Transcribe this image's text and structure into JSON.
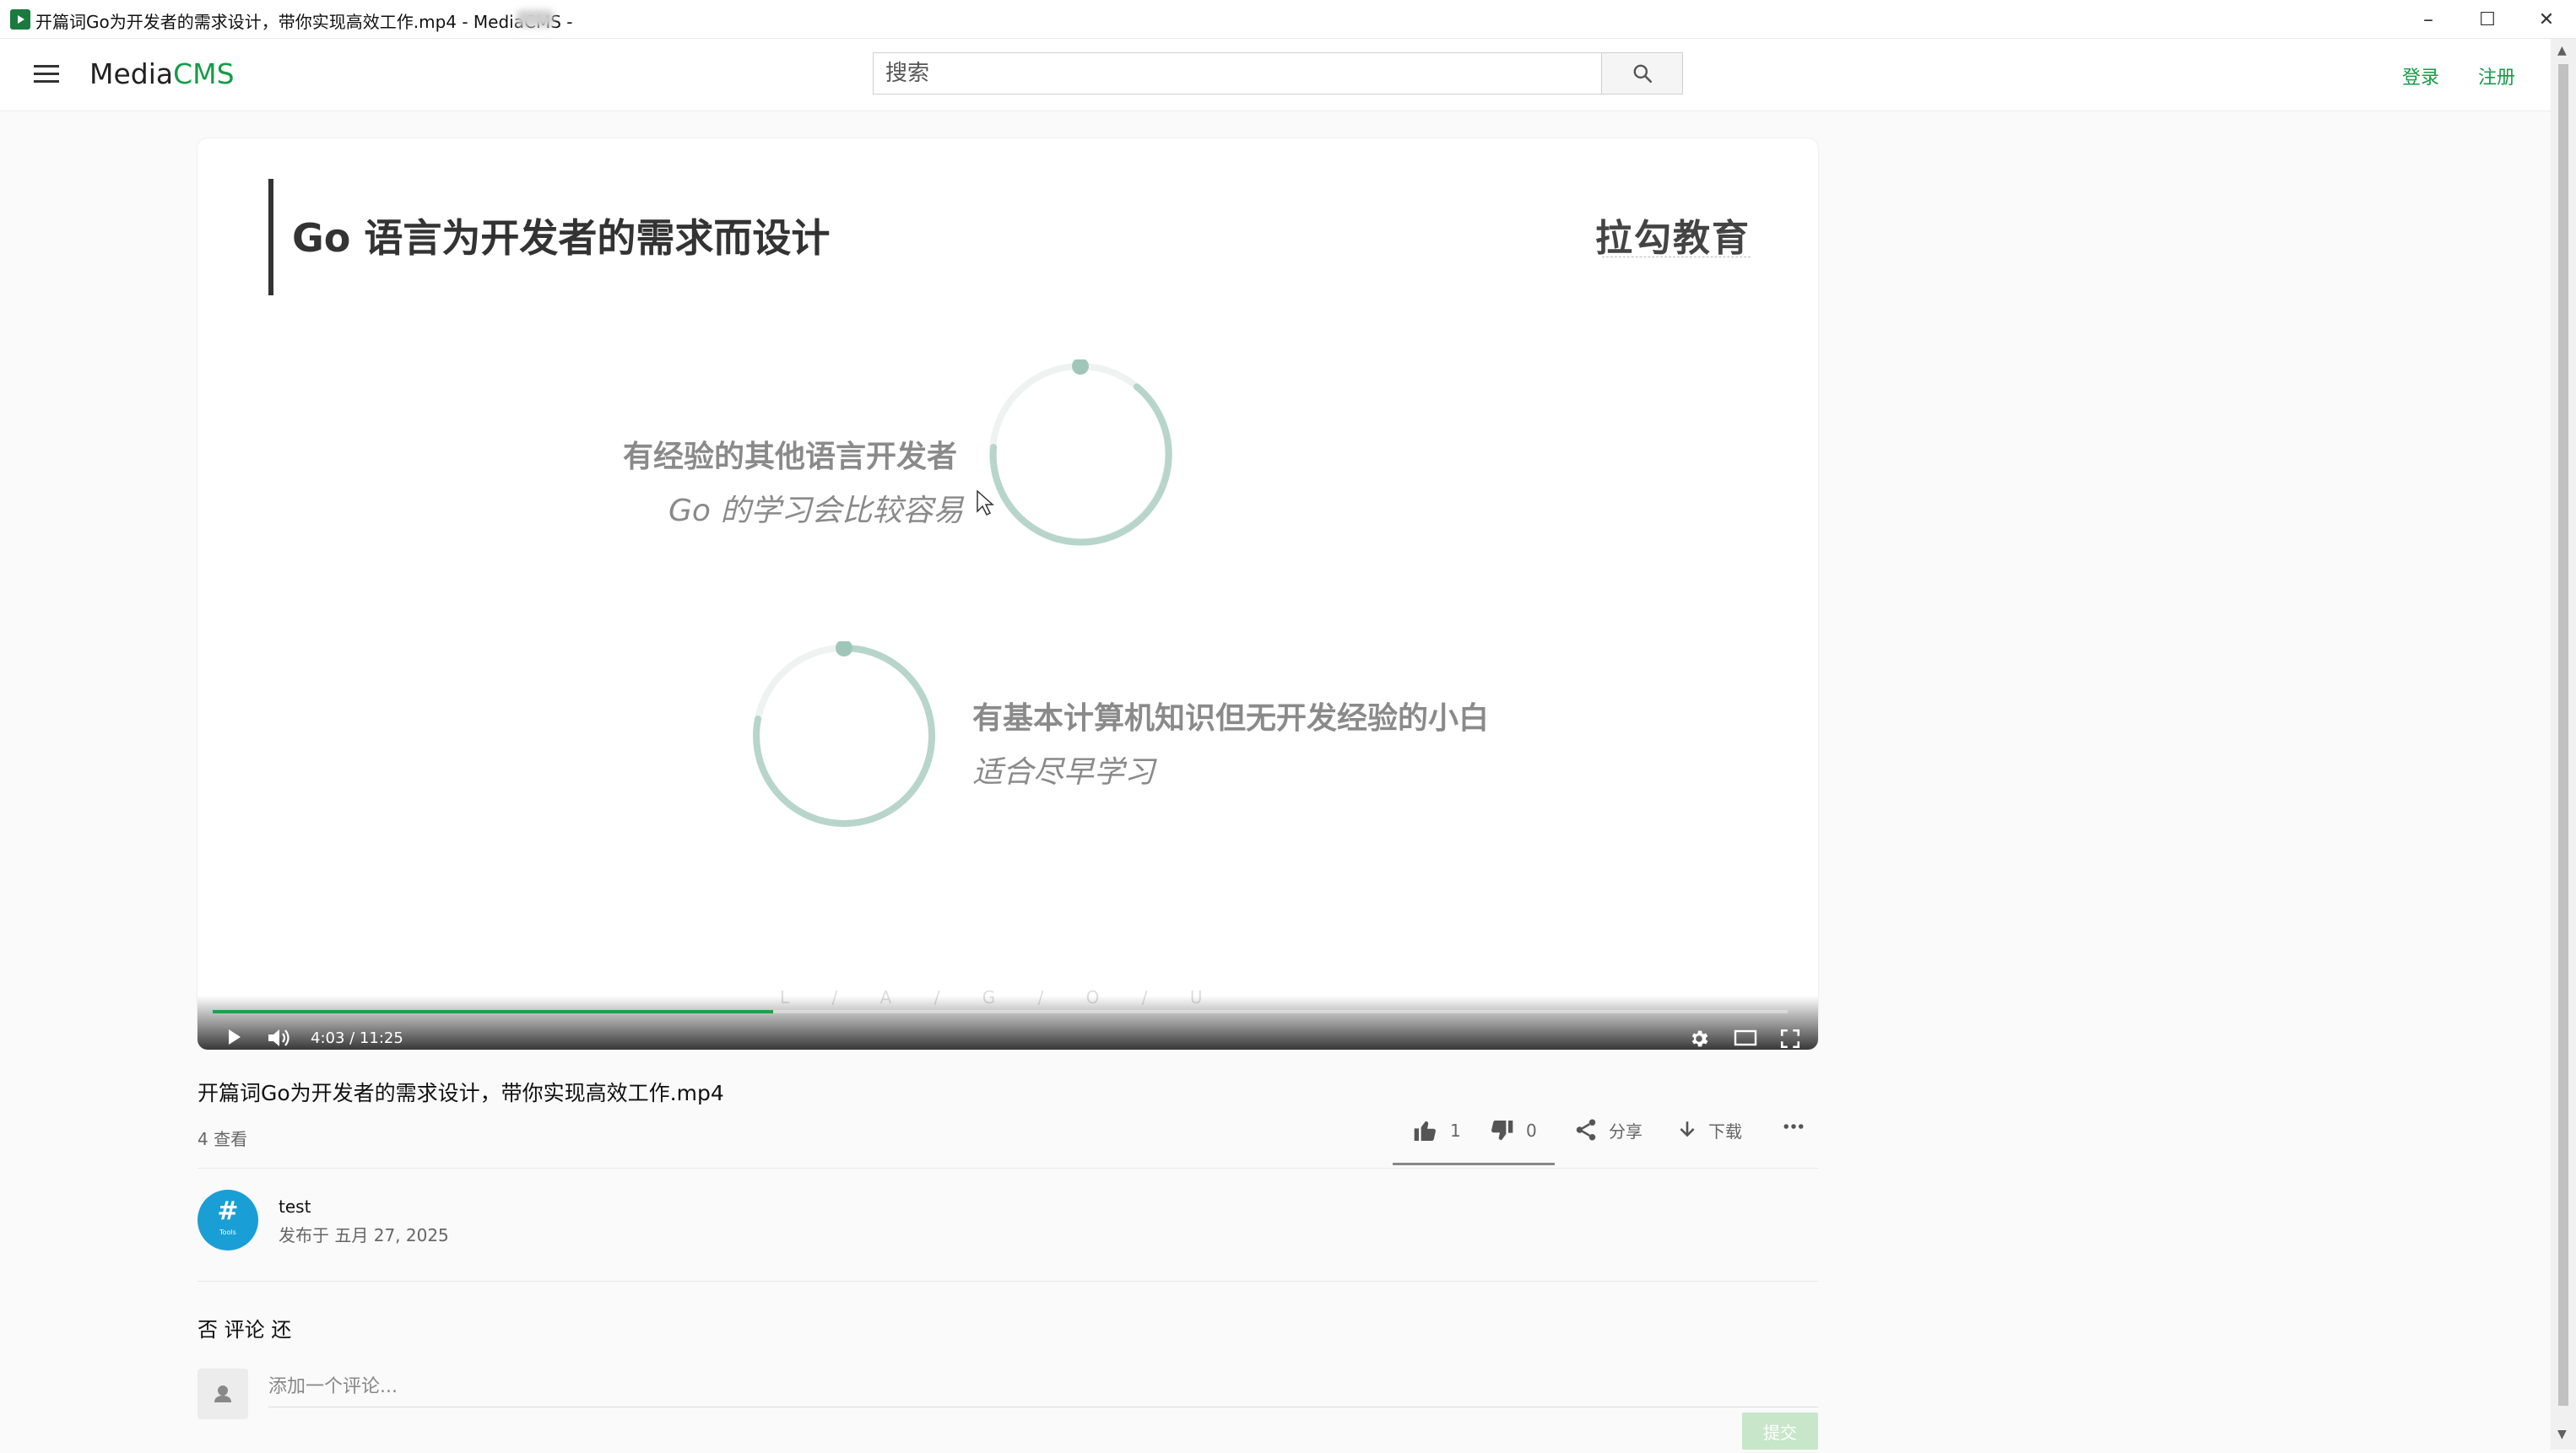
{
  "window": {
    "title": "开篇词Go为开发者的需求设计，带你实现高效工作.mp4 - MediaCMS - ",
    "minimize_symbol": "–",
    "maximize_symbol": "☐",
    "close_symbol": "✕"
  },
  "header": {
    "logo_media": "Media",
    "logo_cms": "CMS",
    "search_placeholder": "搜索",
    "login": "登录",
    "register": "注册"
  },
  "video": {
    "slide_title": "Go 语言为开发者的需求而设计",
    "slide_logo": "拉勾教育",
    "point1_heading": "有经验的其他语言开发者",
    "point1_text": "Go 的学习会比较容易",
    "point2_heading": "有基本计算机知识但无开发经验的小白",
    "point2_text": "适合尽早学习",
    "watermark": "L / A / G / O / U",
    "time": "4:03 / 11:25",
    "progress_fraction": 0.356
  },
  "media": {
    "title": "开篇词Go为开发者的需求设计，带你实现高效工作.mp4",
    "views": "4 查看",
    "likes": "1",
    "dislikes": "0",
    "share": "分享",
    "download": "下载"
  },
  "author": {
    "avatar_symbol": "#",
    "avatar_sub": "Tools",
    "name": "test",
    "published": "发布于 五月 27, 2025"
  },
  "comments": {
    "heading": "否 评论 还",
    "placeholder": "添加一个评论...",
    "submit": "提交"
  },
  "colors": {
    "brand_green": "#159c48",
    "progress_green": "#1aa34a",
    "avatar_blue": "#1a9ed6",
    "ring_color": "#b7d5cb"
  }
}
